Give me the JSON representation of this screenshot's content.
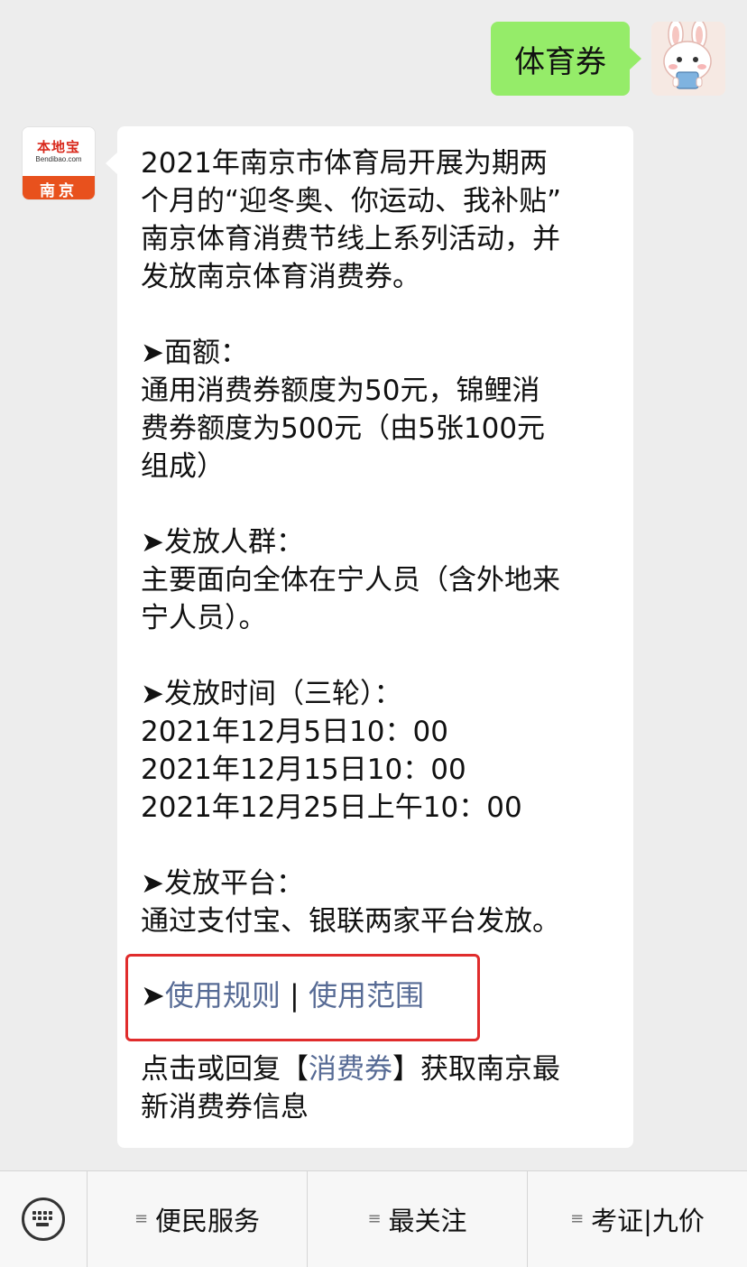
{
  "outgoing": {
    "text": "体育券"
  },
  "sender": {
    "brand_name": "本地宝",
    "brand_url": "Bendibao.com",
    "city": "南京"
  },
  "message": {
    "intro": [
      "2021年南京市体育局开展为期两",
      "个月的“迎冬奥、你运动、我补贴”",
      "南京体育消费节线上系列活动，并",
      "发放南京体育消费券。"
    ],
    "amount_heading": "➤面额：",
    "amount_lines": [
      "通用消费券额度为50元，锦鲤消",
      "费券额度为500元（由5张100元",
      "组成）"
    ],
    "audience_heading": "➤发放人群：",
    "audience_lines": [
      "主要面向全体在宁人员（含外地来",
      "宁人员）。"
    ],
    "time_heading": "➤发放时间（三轮）：",
    "time_lines": [
      "2021年12月5日10：00",
      "2021年12月15日10：00",
      "2021年12月25日上午10：00"
    ],
    "platform_heading": "➤发放平台：",
    "platform_lines": [
      "通过支付宝、银联两家平台发放。"
    ],
    "links_arrow": "➤",
    "link_rules": "使用规则",
    "link_separator": " | ",
    "link_scope": "使用范围",
    "footer_prefix": "点击或回复【",
    "footer_link": "消费券",
    "footer_suffix": "】获取南京最",
    "footer_line2": "新消费券信息"
  },
  "menu": {
    "items": [
      {
        "icon": "menu-lines-icon",
        "label": "便民服务"
      },
      {
        "icon": "menu-lines-icon",
        "label": "最关注"
      },
      {
        "icon": "menu-lines-icon",
        "label": "考证|九价"
      }
    ]
  },
  "colors": {
    "outgoing_bubble": "#95ec69",
    "link": "#576b95",
    "highlight_border": "#e02c2c",
    "brand_red": "#d9291c",
    "brand_orange": "#e8511d"
  }
}
